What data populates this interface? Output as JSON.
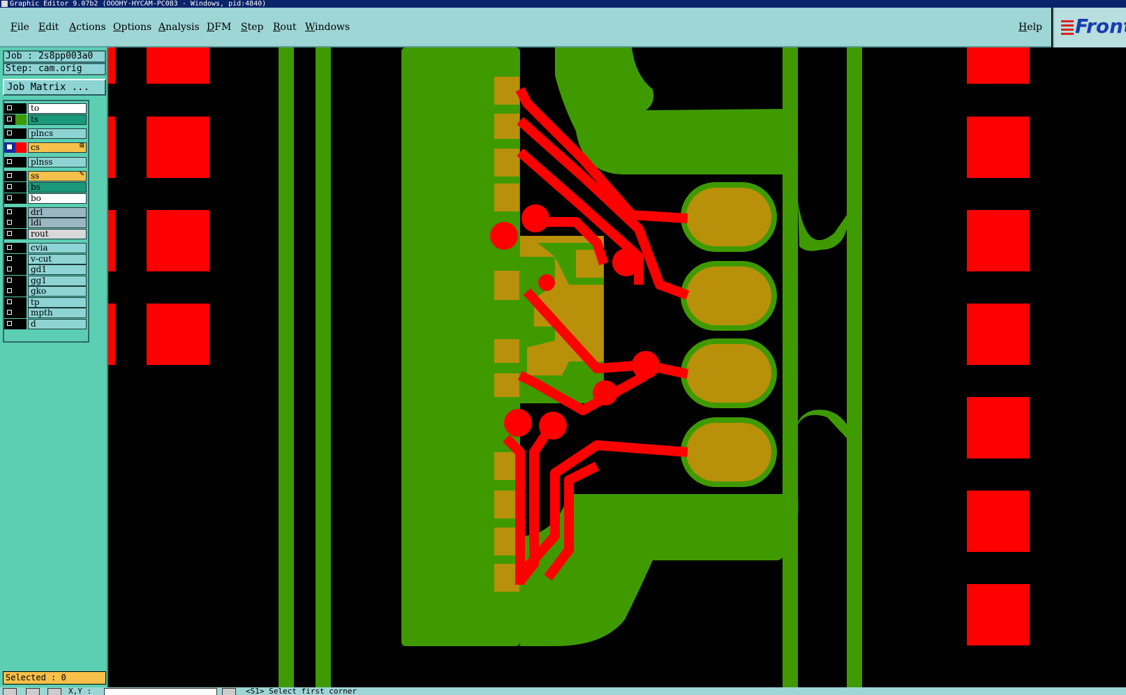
{
  "window": {
    "title": "Graphic Editor 9.07b2  (OOOHY-HYCAM-PC083 - Windows, pid:4840)"
  },
  "menu": {
    "items": [
      "File",
      "Edit",
      "Actions",
      "Options",
      "Analysis",
      "DFM",
      "Step",
      "Rout",
      "Windows"
    ],
    "help": "Help"
  },
  "logo": {
    "text": "Front"
  },
  "job": {
    "label": "Job : 2s8pp003a0",
    "step": "Step: cam.orig",
    "matrix_button": "Job Matrix ..."
  },
  "layers": [
    {
      "name": "to",
      "bg": "#ffffff",
      "swatch": "#000000",
      "selected": false
    },
    {
      "name": "ts",
      "bg": "#1a9a7a",
      "swatch": "#3a9a00",
      "selected": false
    },
    {
      "name": "plncs",
      "bg": "#8ed4d4",
      "swatch": "#000000",
      "selected": false
    },
    {
      "name": "cs",
      "bg": "#f7c04a",
      "swatch": "#ff0000",
      "selected": true,
      "marker": "⊞"
    },
    {
      "name": "plnss",
      "bg": "#8ed4d4",
      "swatch": "#000000",
      "selected": false
    },
    {
      "name": "ss",
      "bg": "#f7c04a",
      "swatch": "#000000",
      "selected": false,
      "marker": "✎"
    },
    {
      "name": "bs",
      "bg": "#1a9a7a",
      "swatch": "#000000",
      "selected": false
    },
    {
      "name": "bo",
      "bg": "#ffffff",
      "swatch": "#000000",
      "selected": false
    },
    {
      "name": "drl",
      "bg": "#9ab6c0",
      "swatch": "#000000",
      "selected": false
    },
    {
      "name": "ldi",
      "bg": "#9ab6c0",
      "swatch": "#000000",
      "selected": false
    },
    {
      "name": "rout",
      "bg": "#d8d8d8",
      "swatch": "#000000",
      "selected": false
    },
    {
      "name": "cvia",
      "bg": "#8ed4d4",
      "swatch": "#000000",
      "selected": false
    },
    {
      "name": "v-cut",
      "bg": "#8ed4d4",
      "swatch": "#000000",
      "selected": false
    },
    {
      "name": "gd1",
      "bg": "#8ed4d4",
      "swatch": "#000000",
      "selected": false
    },
    {
      "name": "gg1",
      "bg": "#8ed4d4",
      "swatch": "#000000",
      "selected": false
    },
    {
      "name": "gko",
      "bg": "#8ed4d4",
      "swatch": "#000000",
      "selected": false
    },
    {
      "name": "tp",
      "bg": "#8ed4d4",
      "swatch": "#000000",
      "selected": false
    },
    {
      "name": "mpth",
      "bg": "#8ed4d4",
      "swatch": "#000000",
      "selected": false
    },
    {
      "name": "d",
      "bg": "#8ed4d4",
      "swatch": "#000000",
      "selected": false
    }
  ],
  "status": {
    "selected": "Selected : 0",
    "xy_label": "X,Y :",
    "prompt": "<S1>   Select first corner"
  },
  "colors": {
    "green": "#3f9a00",
    "red": "#ff0000",
    "gold": "#b8900a",
    "background": "#000000",
    "panel": "#5ccfb2",
    "menubar": "#9ed6d6"
  }
}
